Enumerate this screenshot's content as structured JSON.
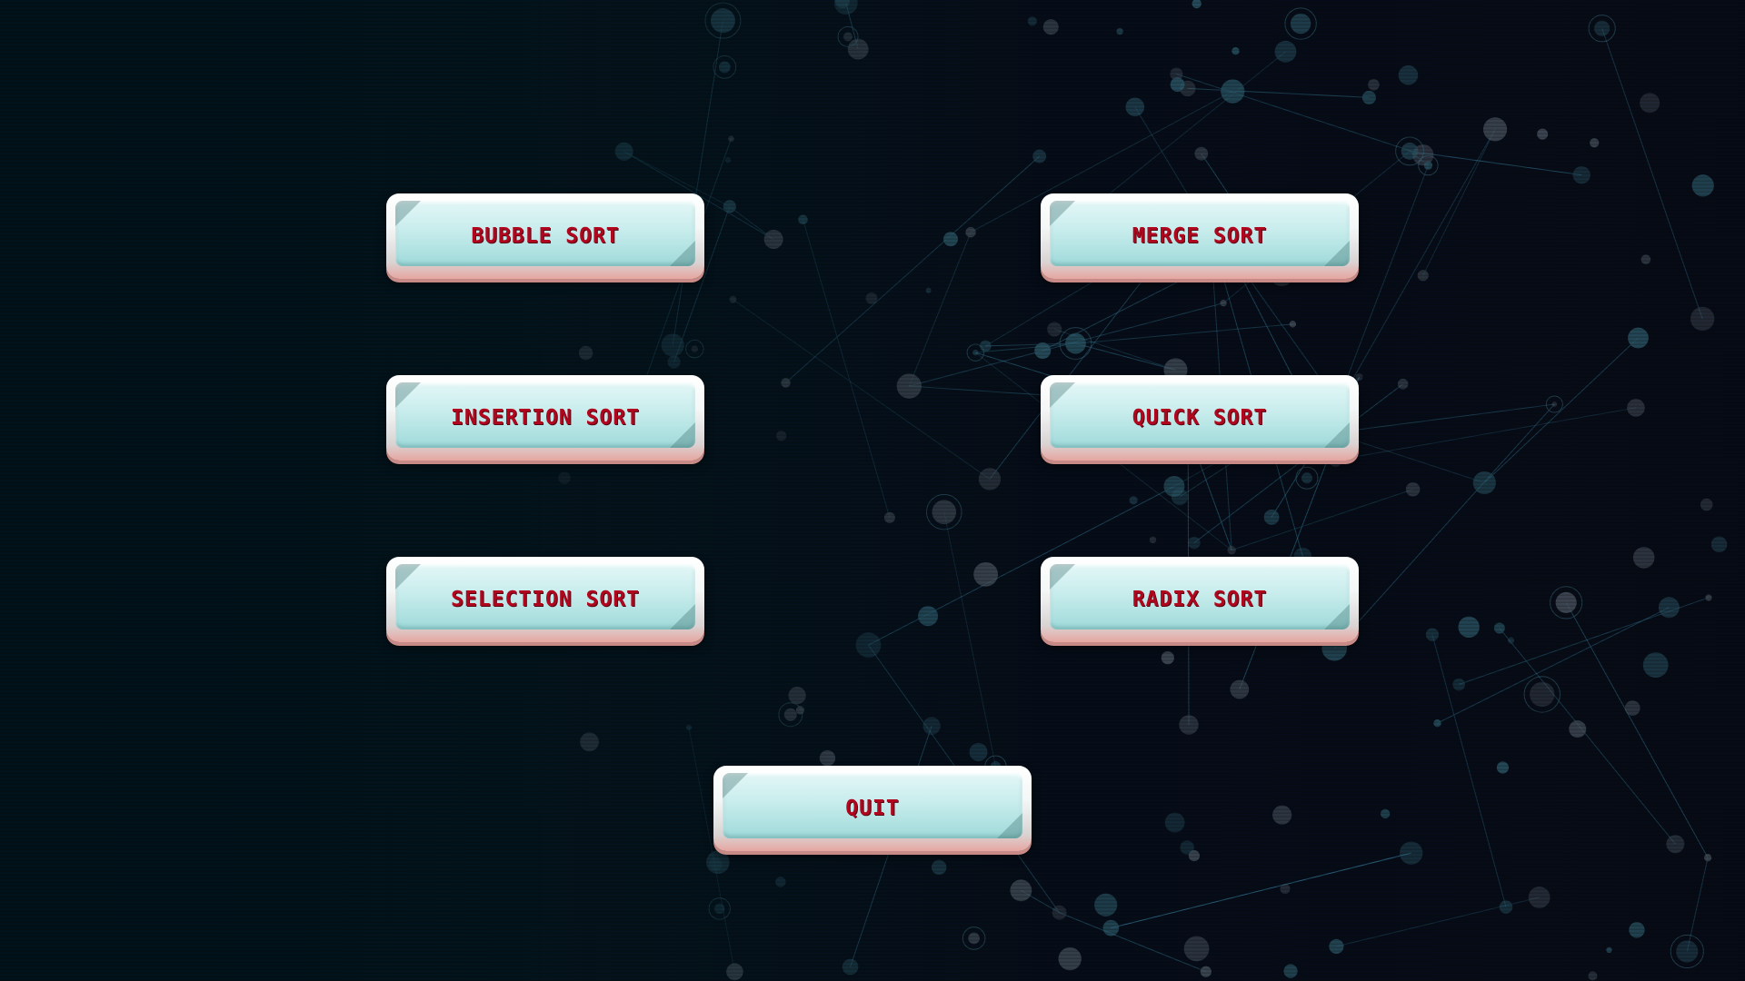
{
  "menu": {
    "bubble_sort": "BUBBLE SORT",
    "merge_sort": "MERGE SORT",
    "insertion_sort": "INSERTION SORT",
    "quick_sort": "QUICK SORT",
    "selection_sort": "SELECTION SORT",
    "radix_sort": "RADIX SORT",
    "quit": "QUIT"
  },
  "colors": {
    "background": "#040b14",
    "button_face": "#c8ecec",
    "button_rim": "#e6a6a0",
    "label_text": "#b0061e",
    "network_line": "#2f6f8a"
  }
}
